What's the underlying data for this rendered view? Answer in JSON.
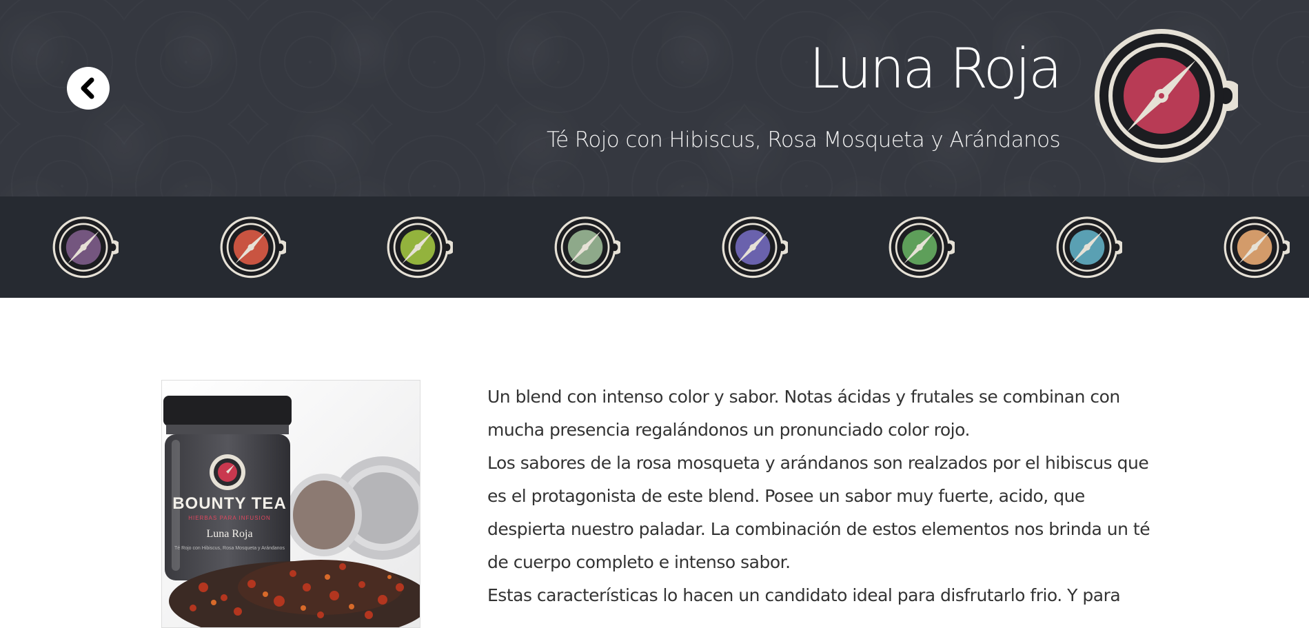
{
  "header": {
    "title": "Luna Roja",
    "subtitle": "Té Rojo con Hibiscus, Rosa Mosqueta y Arándanos",
    "back_icon": "chevron-left-icon",
    "logo_icon": "compass-cup-icon",
    "accent_color": "#b83b55",
    "ring_color": "#e6e1d6"
  },
  "tea_strip": {
    "items": [
      {
        "icon": "compass-cup-icon",
        "color": "#74567f"
      },
      {
        "icon": "compass-cup-icon",
        "color": "#c95441"
      },
      {
        "icon": "compass-cup-icon",
        "color": "#93b33d"
      },
      {
        "icon": "compass-cup-icon",
        "color": "#8ea98a"
      },
      {
        "icon": "compass-cup-icon",
        "color": "#6a62ad"
      },
      {
        "icon": "compass-cup-icon",
        "color": "#5e9f5a"
      },
      {
        "icon": "compass-cup-icon",
        "color": "#5aa0b3"
      },
      {
        "icon": "compass-cup-icon",
        "color": "#d39b6a"
      }
    ]
  },
  "product_image": {
    "brand": "BOUNTY TEA",
    "tagline": "HIERBAS PARA INFUSION",
    "name": "Luna Roja",
    "small_text": "Té Rojo con Hibiscus, Rosa Mosqueta y Arándanos"
  },
  "description": {
    "paragraphs": [
      "Un blend con intenso color y sabor. Notas ácidas y frutales se combinan con mucha presencia regalándonos un pronunciado color rojo.",
      "Los sabores de la rosa mosqueta y arándanos son realzados por el hibiscus que es el protagonista de este blend. Posee un sabor muy fuerte, acido, que despierta nuestro paladar. La combinación de estos elementos nos brinda un té de cuerpo completo e intenso sabor.",
      "Estas características lo hacen un candidato ideal para disfrutarlo frio. Y para"
    ]
  }
}
